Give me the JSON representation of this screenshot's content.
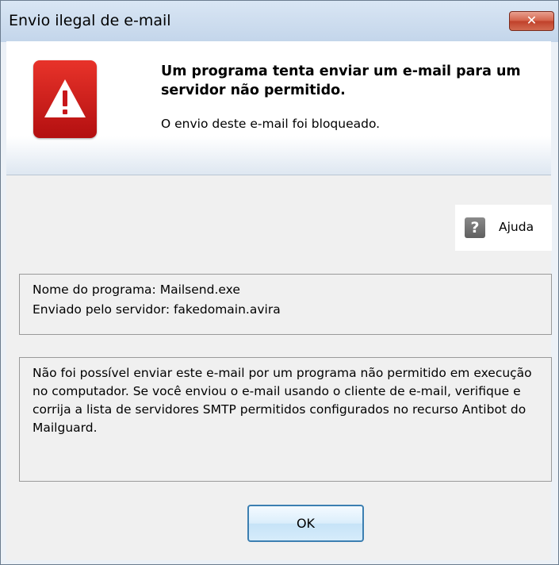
{
  "window": {
    "title": "Envio ilegal de e-mail",
    "close_label": "✕"
  },
  "header": {
    "icon": "warning-icon",
    "icon_color": "#c8171a",
    "headline": "Um programa tenta enviar um e-mail para um servidor não permitido.",
    "subline": "O envio deste e-mail foi bloqueado."
  },
  "help": {
    "icon": "question-icon",
    "icon_glyph": "?",
    "label": "Ajuda"
  },
  "info": {
    "program_line": "Nome do programa: Mailsend.exe",
    "server_line": "Enviado pelo servidor: fakedomain.avira"
  },
  "description": "Não foi possível enviar este e-mail por um programa não permitido em execução no computador. Se você enviou o e-mail usando o cliente de e-mail, verifique e corrija a lista de servidores SMTP permitidos configurados no recurso Antibot do Mailguard.",
  "buttons": {
    "ok_label": "OK"
  }
}
